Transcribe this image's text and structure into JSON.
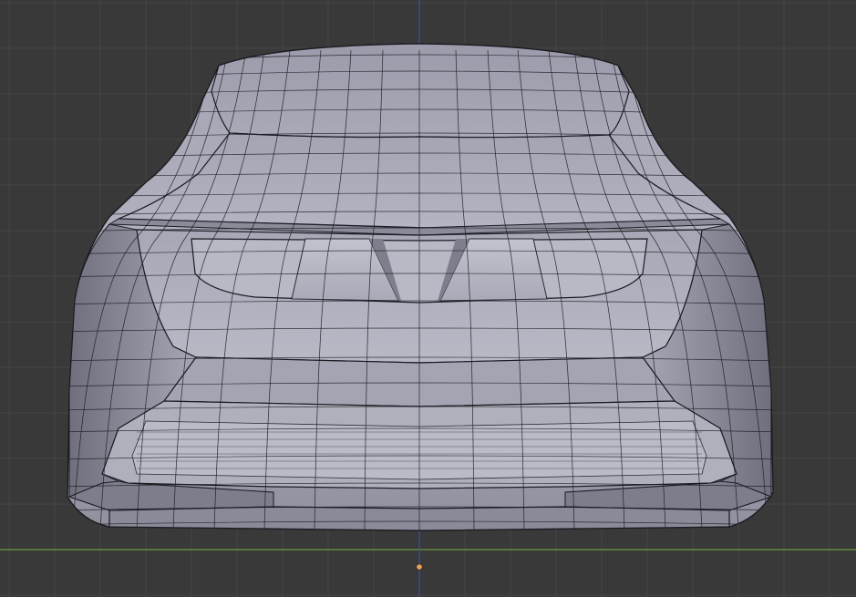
{
  "viewport": {
    "view": "front-orthographic",
    "mode": "edit",
    "shading": "solid",
    "grid_visible": true,
    "object_type": "car-body-mesh",
    "colors": {
      "background": "#393939",
      "grid_line": "#454545",
      "x_axis": "#6d9b3a",
      "z_axis": "#3e4fa0",
      "mesh_light": "#b8b8c6",
      "mesh_mid": "#9c9cab",
      "mesh_dark": "#6a6a78",
      "wire": "#1b1b22",
      "origin": "#e8a262"
    }
  }
}
